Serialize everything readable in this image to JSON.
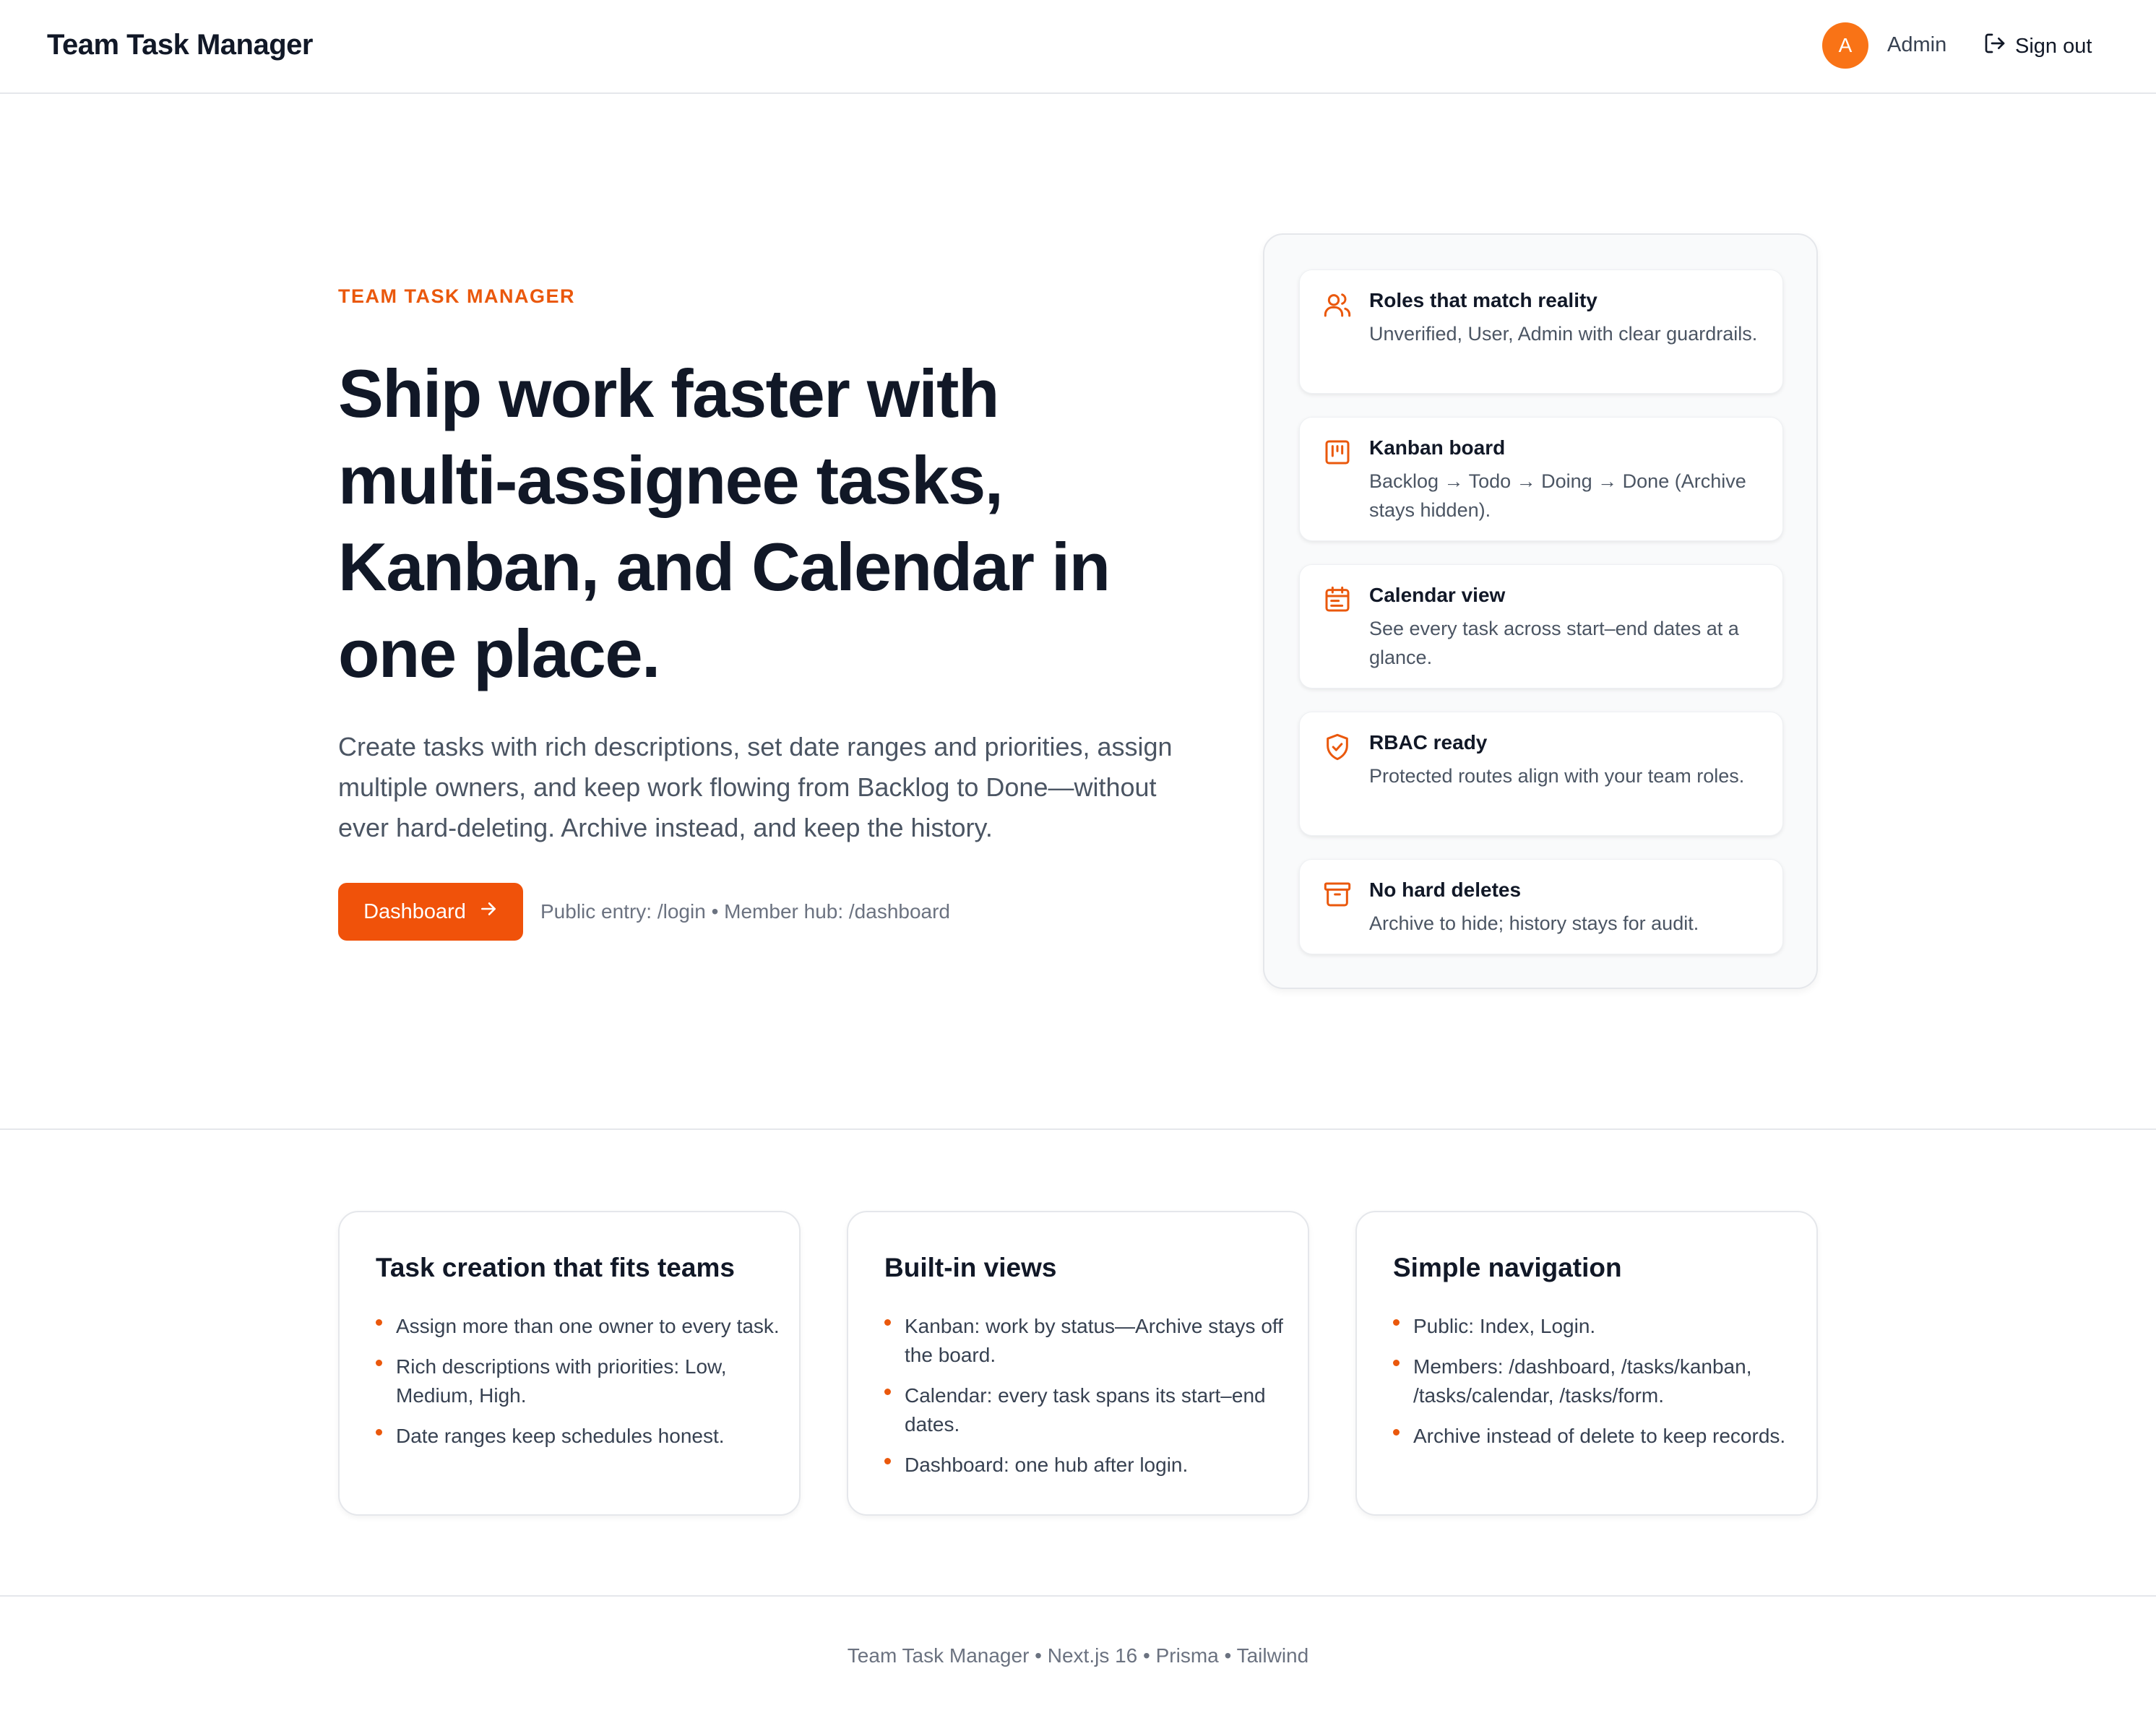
{
  "header": {
    "brand": "Team Task Manager",
    "avatar_initial": "A",
    "user_name": "Admin",
    "signout_label": "Sign out"
  },
  "hero": {
    "eyebrow": "TEAM TASK MANAGER",
    "title": "Ship work faster with multi-assignee tasks, Kanban, and Calendar in one place.",
    "description": "Create tasks with rich descriptions, set date ranges and priorities, assign multiple owners, and keep work flowing from Backlog to Done—without ever hard-deleting. Archive instead, and keep the history.",
    "cta_label": "Dashboard",
    "cta_note": "Public entry: /login • Member hub: /dashboard"
  },
  "features": [
    {
      "icon": "users-icon",
      "title": "Roles that match reality",
      "desc": "Unverified, User, Admin with clear guardrails."
    },
    {
      "icon": "kanban-icon",
      "title": "Kanban board",
      "desc": "Backlog → Todo → Doing → Done (Archive stays hidden)."
    },
    {
      "icon": "calendar-icon",
      "title": "Calendar view",
      "desc": "See every task across start–end dates at a glance."
    },
    {
      "icon": "shield-check-icon",
      "title": "RBAC ready",
      "desc": "Protected routes align with your team roles."
    },
    {
      "icon": "archive-icon",
      "title": "No hard deletes",
      "desc": "Archive to hide; history stays for audit."
    }
  ],
  "cards": [
    {
      "title": "Task creation that fits teams",
      "items": [
        "Assign more than one owner to every task.",
        "Rich descriptions with priorities: Low, Medium, High.",
        "Date ranges keep schedules honest."
      ]
    },
    {
      "title": "Built-in views",
      "items": [
        "Kanban: work by status—Archive stays off the board.",
        "Calendar: every task spans its start–end dates.",
        "Dashboard: one hub after login."
      ]
    },
    {
      "title": "Simple navigation",
      "items": [
        "Public: Index, Login.",
        "Members: /dashboard, /tasks/kanban, /tasks/calendar, /tasks/form.",
        "Archive instead of delete to keep records."
      ]
    }
  ],
  "footer": {
    "text": "Team Task Manager • Next.js 16 • Prisma • Tailwind"
  },
  "colors": {
    "accent": "#f0520a",
    "accent_text": "#ea580c",
    "avatar": "#f97316"
  }
}
